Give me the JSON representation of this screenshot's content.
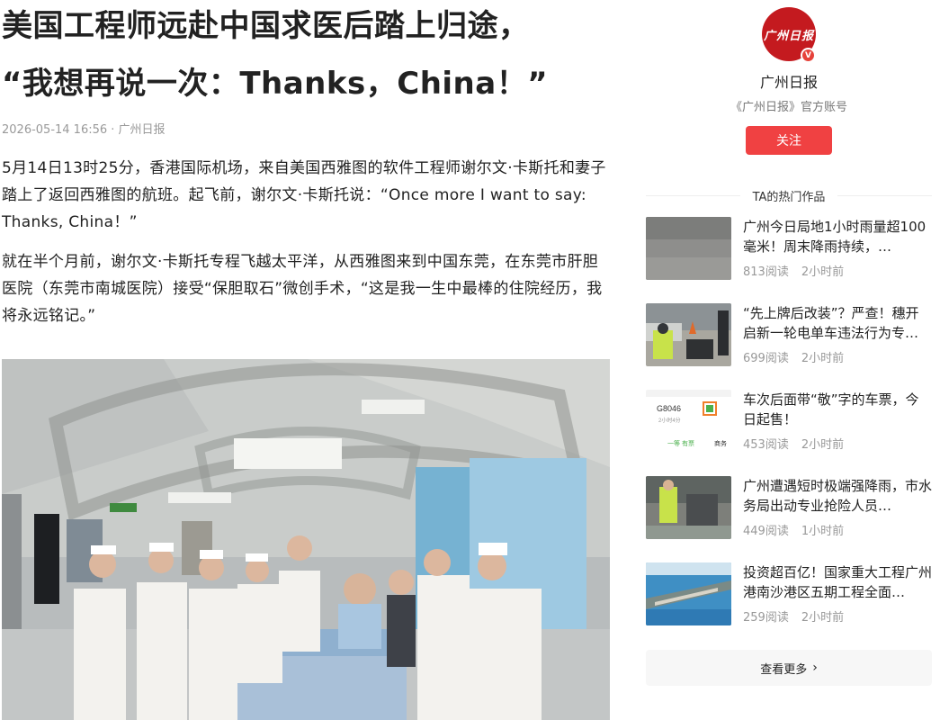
{
  "article": {
    "title_line1": "美国工程师远赴中国求医后踏上归途，",
    "title_line2": "“我想再说一次：Thanks，China！”",
    "meta": "2026-05-14 16:56 · 广州日报",
    "paragraph1": "5月14日13时25分，香港国际机场，来自美国西雅图的软件工程师谢尔文·卡斯托和妻子踏上了返回西雅图的航班。起飞前，谢尔文·卡斯托说：“Once more I want to say: Thanks, China！”",
    "paragraph2": "就在半个月前，谢尔文·卡斯托专程飞越太平洋，从西雅图来到中国东莞，在东莞市肝胆医院（东莞市南城医院）接受“保胆取石”微创手术，“这是我一生中最棒的住院经历，我将永远铭记。”"
  },
  "account": {
    "logo_text": "广州日报",
    "verified_badge": "V",
    "name": "广州日报",
    "description": "《广州日报》官方账号",
    "follow_label": "关注"
  },
  "hot_works": {
    "heading": "TA的热门作品",
    "items": [
      {
        "title": "广州今日局地1小时雨量超100毫米！周末降雨持续，…",
        "reads": "813阅读",
        "time": "2小时前"
      },
      {
        "title": "“先上牌后改装”？严查！穗开启新一轮电单车违法行为专…",
        "reads": "699阅读",
        "time": "2小时前"
      },
      {
        "title": "车次后面带“敬”字的车票，今日起售！",
        "reads": "453阅读",
        "time": "2小时前",
        "thumb_train": "G8046",
        "thumb_left": "一等 有票",
        "thumb_right": "商务",
        "thumb_sub": "2小时4分"
      },
      {
        "title": "广州遭遇短时极端强降雨，市水务局出动专业抢险人员…",
        "reads": "449阅读",
        "time": "1小时前"
      },
      {
        "title": "投资超百亿！国家重大工程广州港南沙港区五期工程全面…",
        "reads": "259阅读",
        "time": "2小时前"
      }
    ],
    "more_label": "查看更多",
    "more_chevron": "›"
  },
  "colors": {
    "accent_red": "#f04142",
    "logo_red": "#c41a1f",
    "meta_gray": "#999999"
  }
}
